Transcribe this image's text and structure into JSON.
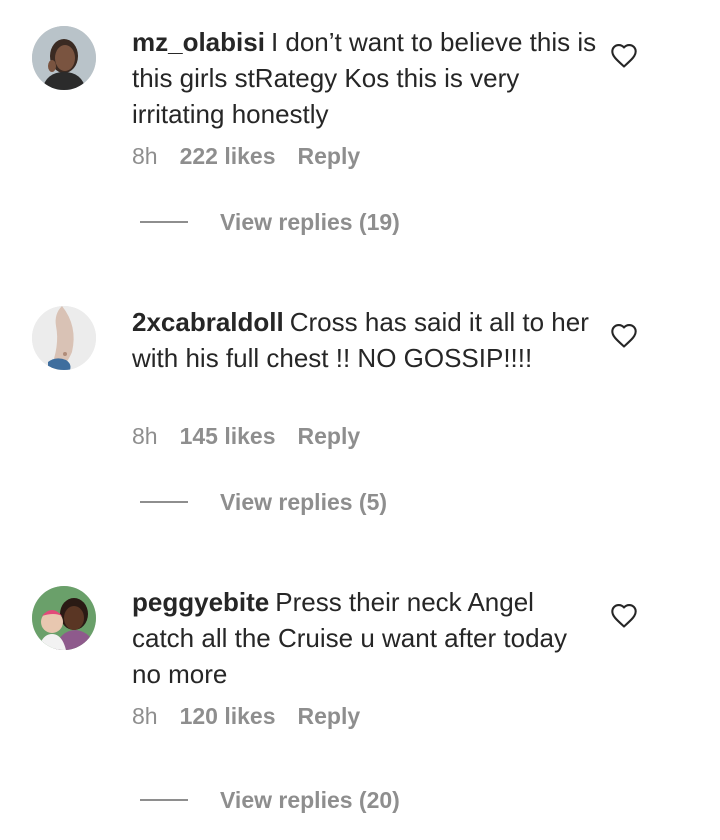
{
  "comments": [
    {
      "username": "mz_olabisi",
      "text": "I don’t want to believe this is this girls stRategy Kos this is very irritating honestly",
      "time": "8h",
      "likes": "222 likes",
      "reply": "Reply",
      "view_replies": "View replies (19)"
    },
    {
      "username": "2xcabraldoll",
      "text": "Cross has said it all to her with his full chest !! NO GOSSIP!!!!",
      "time": "8h",
      "likes": "145 likes",
      "reply": "Reply",
      "view_replies": "View replies (5)"
    },
    {
      "username": "peggyebite",
      "text": "Press their neck Angel catch all the Cruise u want after today no more",
      "time": "8h",
      "likes": "120 likes",
      "reply": "Reply",
      "view_replies": "View replies (20)"
    }
  ],
  "icons": {
    "like": "heart-outline-icon"
  },
  "colors": {
    "text": "#262626",
    "secondary": "#8e8e8e",
    "background": "#ffffff"
  }
}
